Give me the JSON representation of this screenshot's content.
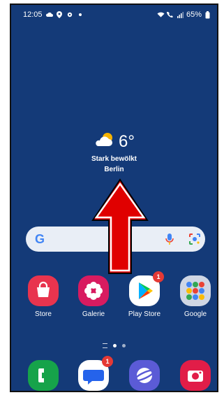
{
  "status_bar": {
    "time": "12:05",
    "battery": "65%",
    "icons_left": [
      "cloud-icon",
      "location-icon",
      "settings-icon",
      "dot-icon"
    ],
    "icons_right": [
      "wifi-icon",
      "call-icon",
      "signal-icon",
      "battery-icon"
    ]
  },
  "weather": {
    "temperature": "6°",
    "description": "Stark bewölkt",
    "city": "Berlin",
    "icon": "partly-cloudy-icon"
  },
  "search_bar": {
    "logo": "G",
    "icons": [
      "mic-icon",
      "lens-icon"
    ]
  },
  "apps": [
    {
      "label": "Store",
      "icon": "store-icon",
      "color": "#e8344e"
    },
    {
      "label": "Galerie",
      "icon": "gallery-icon",
      "color": "#d81b60"
    },
    {
      "label": "Play Store",
      "icon": "play-store-icon",
      "color": "#ffffff",
      "badge": "1"
    },
    {
      "label": "Google",
      "icon": "google-folder-icon",
      "color": "#cfd6e4"
    }
  ],
  "dock": [
    {
      "icon": "phone-icon",
      "color": "#16a34a"
    },
    {
      "icon": "messages-icon",
      "color": "#2563eb",
      "badge": "1"
    },
    {
      "icon": "internet-icon",
      "color": "#5b5bd6"
    },
    {
      "icon": "camera-icon",
      "color": "#e11d48"
    }
  ],
  "overlay": {
    "arrow": "swipe-up-arrow",
    "arrow_color": "#e00000"
  }
}
